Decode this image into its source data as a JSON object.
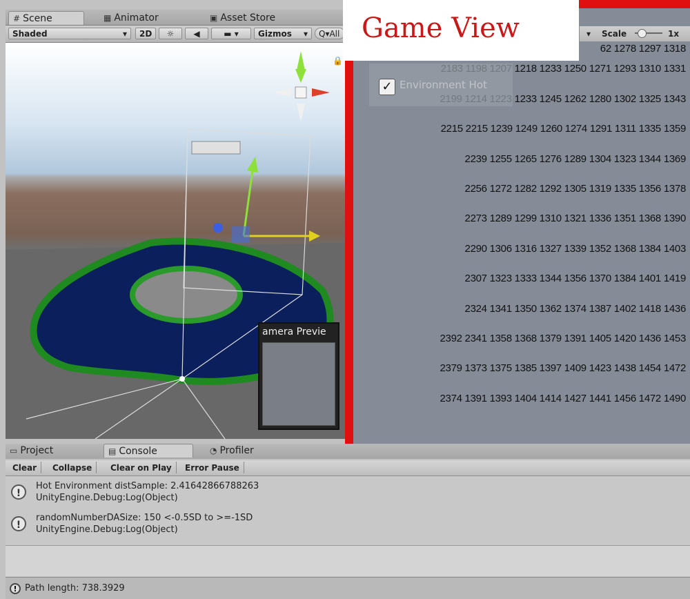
{
  "scene_tabs": [
    {
      "label": "Scene",
      "icon": "grid-icon"
    },
    {
      "label": "Animator",
      "icon": "animator-icon"
    },
    {
      "label": "Asset Store",
      "icon": "store-icon"
    }
  ],
  "scene_toolbar": {
    "shading_mode": "Shaded",
    "mode_2d": "2D",
    "gizmos_label": "Gizmos",
    "search_placeholder": "Q▾All"
  },
  "camera_preview_title": "amera Previe",
  "game_view": {
    "label": "Game View",
    "scale_label": "Scale",
    "scale_value": "1x",
    "toggle_label": "Environment Hot",
    "toggle_checked": true,
    "rows": [
      "62 1278 1297 1318",
      "2183 1198 1207 1218 1233 1250 1271 1293 1310 1331",
      "2199 1214 1223 1233 1245 1262 1280 1302 1325 1343",
      "2215 2215 1239 1249 1260 1274 1291 1311 1335 1359",
      "2239 1255 1265 1276 1289 1304 1323 1344 1369",
      "2256 1272 1282 1292 1305 1319 1335 1356 1378",
      "2273 1289 1299 1310 1321 1336 1351 1368 1390",
      "2290 1306 1316 1327 1339 1352 1368 1384 1403",
      "2307 1323 1333 1344 1356 1370 1384 1401 1419",
      "2324 1341 1350 1362 1374 1387 1402 1418 1436",
      "2392 2341 1358 1368 1379 1391 1405 1420 1436 1453",
      "2379 1373 1375 1385 1397 1409 1423 1438 1454 1472",
      "2374 1391 1393 1404 1414 1427 1441 1456 1472 1490"
    ]
  },
  "bottom_tabs": [
    {
      "label": "Project",
      "icon": "folder-icon"
    },
    {
      "label": "Console",
      "icon": "console-icon"
    },
    {
      "label": "Profiler",
      "icon": "profiler-icon"
    }
  ],
  "console_toolbar": {
    "clear": "Clear",
    "collapse": "Collapse",
    "clear_on_play": "Clear on Play",
    "error_pause": "Error Pause"
  },
  "console_entries": [
    {
      "line1": "Hot Environment distSample: 2.41642866788263",
      "line2": "UnityEngine.Debug:Log(Object)"
    },
    {
      "line1": "randomNumberDASize: 150 <-0.5SD to >=-1SD",
      "line2": "UnityEngine.Debug:Log(Object)"
    }
  ],
  "status_bar": {
    "text": "Path length: 738.3929"
  },
  "colors": {
    "game_frame": "#e01010",
    "game_label": "#c81818",
    "game_bg": "#858c98"
  }
}
